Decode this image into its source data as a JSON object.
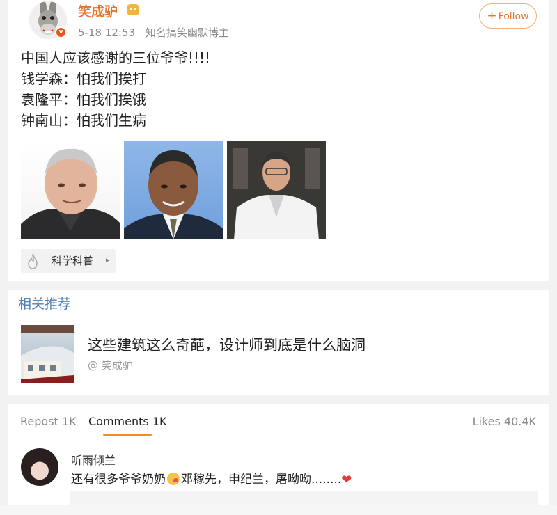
{
  "post": {
    "username": "笑成驴",
    "vip_icon": "vip-icon",
    "verified_icon": "verified-v-icon",
    "time": "5-18 12:53",
    "author_desc": "知名搞笑幽默博主",
    "follow_label": "Follow",
    "lines": [
      "中国人应该感谢的三位爷爷!!!!",
      "钱学森：怕我们挨打",
      "袁隆平：怕我们挨饿",
      "钟南山：怕我们生病"
    ],
    "topic": "科学科普",
    "colors": {
      "username": "#e8742a",
      "accent": "#f08a2c",
      "link": "#4e7fb7"
    }
  },
  "related": {
    "title": "相关推荐",
    "headline": "这些建筑这么奇葩，设计师到底是什么脑洞",
    "author": "@ 笑成驴"
  },
  "comments": {
    "tab_repost": "Repost 1K",
    "tab_comments": "Comments 1K",
    "likes": "Likes 40.4K",
    "items": [
      {
        "name": "听雨倾兰",
        "text_before": "还有很多爷爷奶奶",
        "text_after": "邓稼先，申纪兰，屠呦呦........"
      }
    ]
  }
}
